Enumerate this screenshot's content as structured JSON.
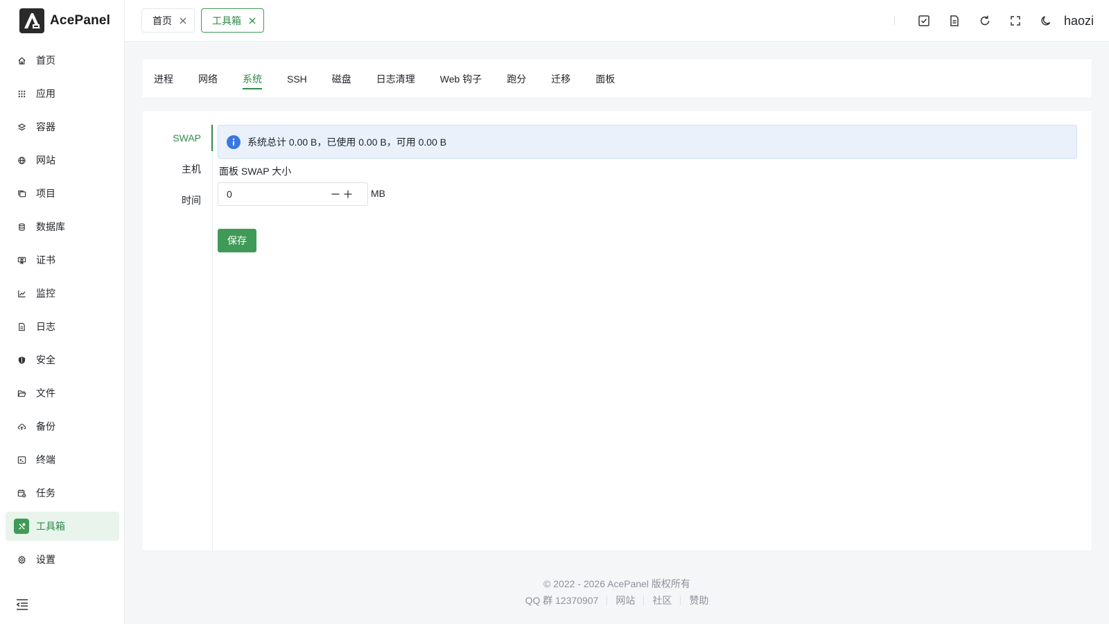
{
  "app": {
    "name": "AcePanel"
  },
  "colors": {
    "accent": "#3f9a57",
    "info": "#3a78e0"
  },
  "sidebar": {
    "items": [
      {
        "label": "首页",
        "icon": "home-icon"
      },
      {
        "label": "应用",
        "icon": "apps-grid-icon"
      },
      {
        "label": "容器",
        "icon": "layers-icon"
      },
      {
        "label": "网站",
        "icon": "globe-icon"
      },
      {
        "label": "项目",
        "icon": "folders-icon"
      },
      {
        "label": "数据库",
        "icon": "database-icon"
      },
      {
        "label": "证书",
        "icon": "certificate-icon"
      },
      {
        "label": "监控",
        "icon": "chart-line-icon"
      },
      {
        "label": "日志",
        "icon": "file-text-icon"
      },
      {
        "label": "安全",
        "icon": "shield-icon"
      },
      {
        "label": "文件",
        "icon": "folder-open-icon"
      },
      {
        "label": "备份",
        "icon": "cloud-upload-icon"
      },
      {
        "label": "终端",
        "icon": "terminal-icon"
      },
      {
        "label": "任务",
        "icon": "calendar-task-icon"
      },
      {
        "label": "工具箱",
        "icon": "tools-icon",
        "active": true
      },
      {
        "label": "设置",
        "icon": "gear-icon"
      }
    ]
  },
  "topbar": {
    "tabs": [
      {
        "label": "首页"
      },
      {
        "label": "工具箱",
        "active": true
      }
    ],
    "user": "haozi"
  },
  "toolbox": {
    "tabs": [
      "进程",
      "网络",
      "系统",
      "SSH",
      "磁盘",
      "日志清理",
      "Web 钩子",
      "跑分",
      "迁移",
      "面板"
    ],
    "active_tab": "系统"
  },
  "system": {
    "side_tabs": [
      "SWAP",
      "主机",
      "时间"
    ],
    "active_side_tab": "SWAP",
    "alert": "系统总计 0.00 B，已使用 0.00 B，可用 0.00 B",
    "swap_label": "面板 SWAP 大小",
    "swap_value": "0",
    "swap_unit": "MB",
    "save_label": "保存"
  },
  "footer": {
    "copyright": "© 2022 - 2026 AcePanel 版权所有",
    "qq": "QQ 群 12370907",
    "links": [
      "网站",
      "社区",
      "赞助"
    ]
  }
}
